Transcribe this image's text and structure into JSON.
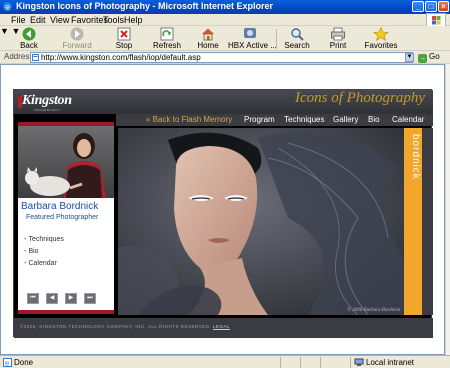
{
  "window": {
    "title": "Kingston Icons of Photography - Microsoft Internet Explorer",
    "controls": {
      "minimize": "_",
      "maximize": "□",
      "close": "×"
    }
  },
  "menu": [
    "File",
    "Edit",
    "View",
    "Favorites",
    "Tools",
    "Help"
  ],
  "toolbar": {
    "back": "Back",
    "forward": "Forward",
    "stop": "Stop",
    "refresh": "Refresh",
    "home": "Home",
    "hbx": "HBX Active ...",
    "search": "Search",
    "print": "Print",
    "favorites": "Favorites"
  },
  "address": {
    "label": "Address",
    "url": "http://www.kingston.com/flash/iop/default.asp",
    "go": "Go",
    "go_icon": "→"
  },
  "site": {
    "logo": "Kingston",
    "logo_tagline": "TECHNOLOGY",
    "banner_title": "Icons of Photography",
    "nav": {
      "back": "« Back to Flash Memory",
      "items": [
        "Program",
        "Techniques",
        "Gallery",
        "Bio",
        "Calendar"
      ]
    },
    "photographer_name": "Barbara Bordnick",
    "photographer_title": "Featured Photographer",
    "links": [
      "Techniques",
      "Bio",
      "Calendar"
    ],
    "controls": [
      "⏮",
      "◀",
      "▶",
      "⏭"
    ],
    "side_name": "bordnick",
    "photo_credit": "© 2006 Barbara Bordnick",
    "footer": "©2006, KINGSTON TECHNOLOGY COMPANY, INC. ALL RIGHTS RESERVED.",
    "footer_link": "LEGAL",
    "colors": {
      "accent_orange": "#F2A62B",
      "brand_red": "#9E1728",
      "name_blue": "#1C4FA0",
      "gold": "#C69A2B"
    }
  },
  "status": {
    "text": "Done",
    "zone": "Local intranet"
  }
}
